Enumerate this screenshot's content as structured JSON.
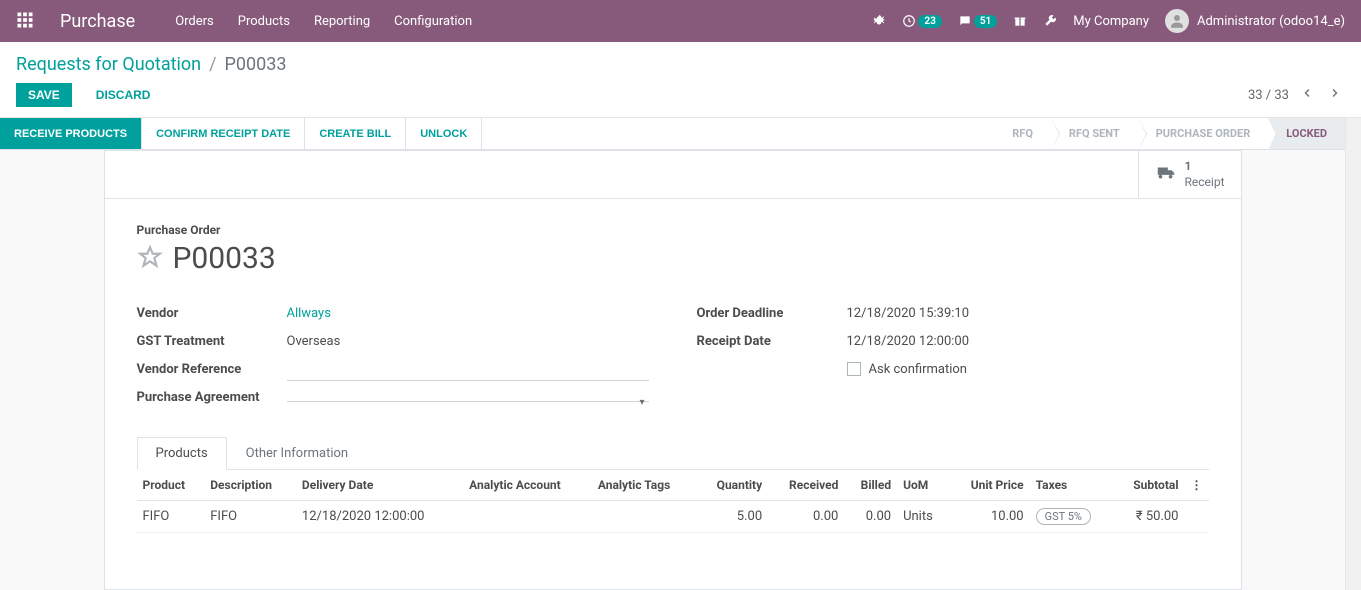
{
  "topbar": {
    "brand": "Purchase",
    "menu": [
      "Orders",
      "Products",
      "Reporting",
      "Configuration"
    ],
    "badge1": "23",
    "badge2": "51",
    "company": "My Company",
    "user": "Administrator (odoo14_e)"
  },
  "breadcrumb": {
    "root": "Requests for Quotation",
    "current": "P00033"
  },
  "actions": {
    "save": "SAVE",
    "discard": "DISCARD",
    "pager": "33 / 33"
  },
  "statusbar": {
    "buttons": {
      "receive": "RECEIVE PRODUCTS",
      "confirm": "CONFIRM RECEIPT DATE",
      "bill": "CREATE BILL",
      "unlock": "UNLOCK"
    },
    "steps": {
      "rfq": "RFQ",
      "sent": "RFQ SENT",
      "po": "PURCHASE ORDER",
      "locked": "LOCKED"
    }
  },
  "statbutton": {
    "count": "1",
    "label": "Receipt"
  },
  "record": {
    "title_label": "Purchase Order",
    "title": "P00033"
  },
  "fields": {
    "vendor": {
      "label": "Vendor",
      "value": "Allways"
    },
    "gst": {
      "label": "GST Treatment",
      "value": "Overseas"
    },
    "vendor_ref": {
      "label": "Vendor Reference",
      "value": ""
    },
    "agreement": {
      "label": "Purchase Agreement",
      "value": ""
    },
    "deadline": {
      "label": "Order Deadline",
      "value": "12/18/2020 15:39:10"
    },
    "receipt_date": {
      "label": "Receipt Date",
      "value": "12/18/2020 12:00:00"
    },
    "ask_conf": {
      "label": "Ask confirmation"
    }
  },
  "tabs": {
    "products": "Products",
    "other": "Other Information"
  },
  "table": {
    "headers": {
      "product": "Product",
      "description": "Description",
      "delivery": "Delivery Date",
      "analytic_account": "Analytic Account",
      "analytic_tags": "Analytic Tags",
      "quantity": "Quantity",
      "received": "Received",
      "billed": "Billed",
      "uom": "UoM",
      "unit_price": "Unit Price",
      "taxes": "Taxes",
      "subtotal": "Subtotal"
    },
    "rows": [
      {
        "product": "FIFO",
        "description": "FIFO",
        "delivery": "12/18/2020 12:00:00",
        "analytic_account": "",
        "analytic_tags": "",
        "quantity": "5.00",
        "received": "0.00",
        "billed": "0.00",
        "uom": "Units",
        "unit_price": "10.00",
        "taxes": "GST 5%",
        "subtotal": "₹ 50.00"
      }
    ]
  }
}
